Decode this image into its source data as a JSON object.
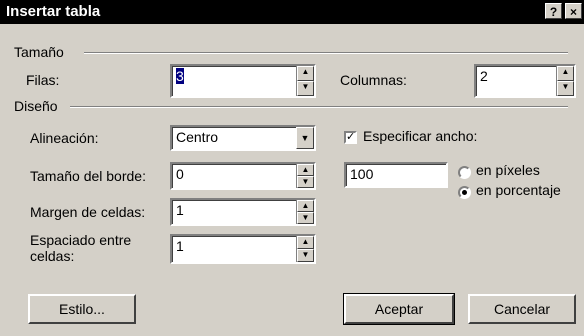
{
  "window": {
    "title": "Insertar tabla",
    "help_label": "?",
    "close_label": "×"
  },
  "size_section": {
    "title": "Tamaño",
    "rows_label": "Filas:",
    "rows_value": "3",
    "cols_label": "Columnas:",
    "cols_value": "2"
  },
  "layout_section": {
    "title": "Diseño",
    "align_label": "Alineación:",
    "align_value": "Centro",
    "border_label": "Tamaño del borde:",
    "border_value": "0",
    "padding_label": "Margen de celdas:",
    "padding_value": "1",
    "spacing_label_line1": "Espaciado entre",
    "spacing_label_line2": "celdas:",
    "spacing_value": "1",
    "width_check_label": "Especificar ancho:",
    "width_checked": true,
    "width_value": "100",
    "unit_pixels": "en píxeles",
    "unit_percent": "en porcentaje",
    "unit_selected": "percent"
  },
  "buttons": {
    "style": "Estilo...",
    "accept": "Aceptar",
    "cancel": "Cancelar"
  },
  "icons": {
    "spin_up": "▲",
    "spin_down": "▼",
    "dropdown": "▼",
    "check": "✓"
  }
}
